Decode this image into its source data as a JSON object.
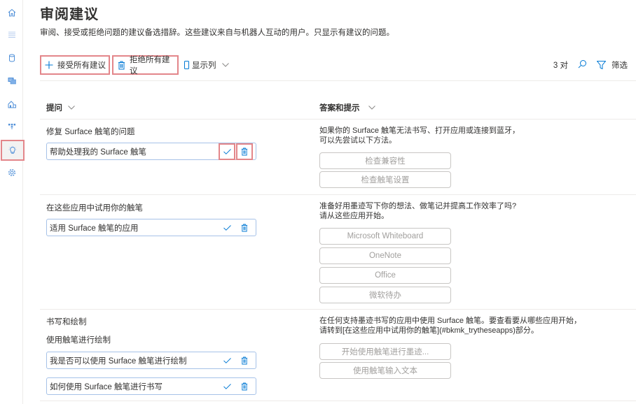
{
  "sidebar": {
    "items": [
      {
        "name": "home",
        "icon": "home-icon"
      },
      {
        "name": "list",
        "icon": "list-icon"
      },
      {
        "name": "database",
        "icon": "database-icon"
      },
      {
        "name": "documents",
        "icon": "documents-icon"
      },
      {
        "name": "building",
        "icon": "building-icon"
      },
      {
        "name": "flow",
        "icon": "flow-icon"
      },
      {
        "name": "suggestions",
        "icon": "lightbulb-icon",
        "active": true
      },
      {
        "name": "settings",
        "icon": "gear-icon"
      }
    ]
  },
  "header": {
    "title": "审阅建议",
    "description": "审阅、接受或拒绝问题的建议备选措辞。这些建议来自与机器人互动的用户。只显示有建议的问题。"
  },
  "toolbar": {
    "accept_all": "接受所有建议",
    "reject_all": "拒绝所有建议",
    "show_columns": "显示列",
    "pair_count": "3 对",
    "filter": "筛选"
  },
  "columns": {
    "question": "提问",
    "answer": "答案和提示"
  },
  "rows": [
    {
      "question": "修复 Surface 触笔的问题",
      "alternates": [],
      "suggestions": [
        "帮助处理我的 Surface 触笔"
      ],
      "answer_lines": [
        "如果你的 Surface 触笔无法书写、打开应用或连接到蓝牙，",
        "可以先尝试以下方法。"
      ],
      "prompts": [
        "检查兼容性",
        "检查触笔设置"
      ]
    },
    {
      "question": "在这些应用中试用你的触笔",
      "alternates": [],
      "suggestions": [
        "适用 Surface 触笔的应用"
      ],
      "answer_lines": [
        "准备好用墨迹写下你的想法、做笔记并提高工作效率了吗?",
        "请从这些应用开始。"
      ],
      "prompts": [
        "Microsoft Whiteboard",
        "OneNote",
        "Office",
        "微软待办"
      ]
    },
    {
      "question": "书写和绘制",
      "alternates": [
        "使用触笔进行绘制"
      ],
      "suggestions": [
        "我是否可以使用 Surface 触笔进行绘制",
        "如何使用 Surface 触笔进行书写"
      ],
      "answer_lines": [
        "在任何支持墨迹书写的应用中使用 Surface 触笔。要查看要从哪些应用开始，",
        "请转到[在这些应用中试用你的触笔](#bkmk_trytheseapps)部分。"
      ],
      "prompts": [
        "开始使用触笔进行墨迹...",
        "使用触笔输入文本"
      ]
    }
  ],
  "colors": {
    "accent": "#0078d4",
    "highlight_outline": "#e3868a",
    "icon_blue": "#4f8fd8"
  }
}
